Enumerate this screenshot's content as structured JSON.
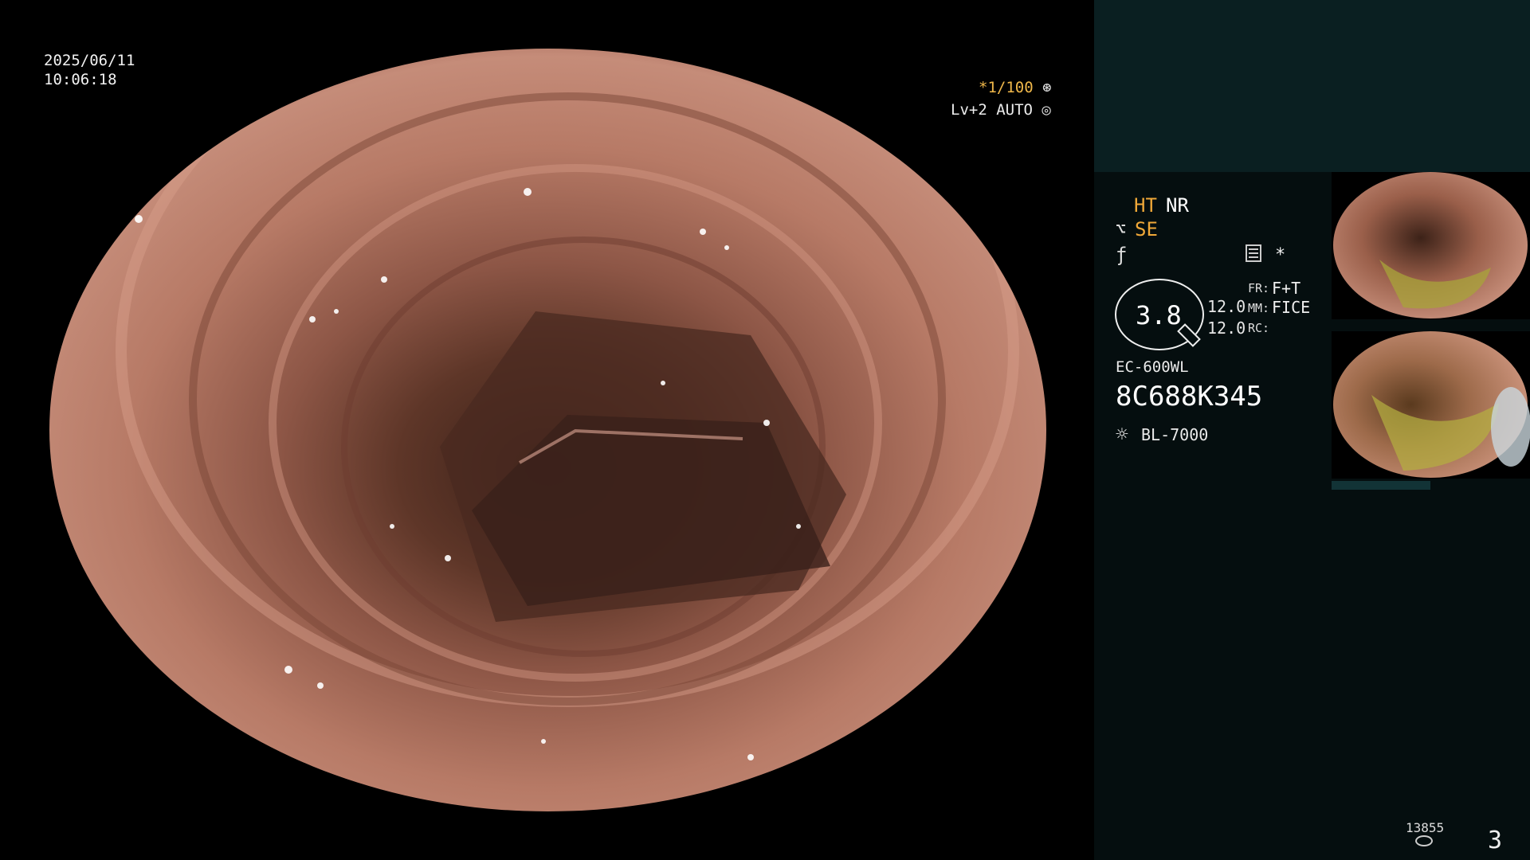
{
  "overlay": {
    "date": "2025/06/11",
    "time": "10:06:18",
    "shutter": "*1/100",
    "shutter_icon": "aperture-icon",
    "level": "Lv+2 AUTO",
    "auto_icon": "auto-iris-icon"
  },
  "status": {
    "ht": "HT",
    "nr": "NR",
    "se": "SE",
    "zoom": "3.8",
    "value_a": "12.0",
    "value_b": "12.0",
    "fr_label": "FR:",
    "fr_value": "F+T",
    "mm_label": "MM:",
    "mm_value": "FICE",
    "rc_label": "RC:",
    "scope_model": "EC-600WL",
    "scope_serial": "8C688K345",
    "light_source": "BL-7000",
    "storage_count": "13855",
    "page_number": "3"
  },
  "colors": {
    "accent_orange": "#f0a838",
    "panel_top": "#0a1f21",
    "panel_bottom": "#050e0f"
  }
}
